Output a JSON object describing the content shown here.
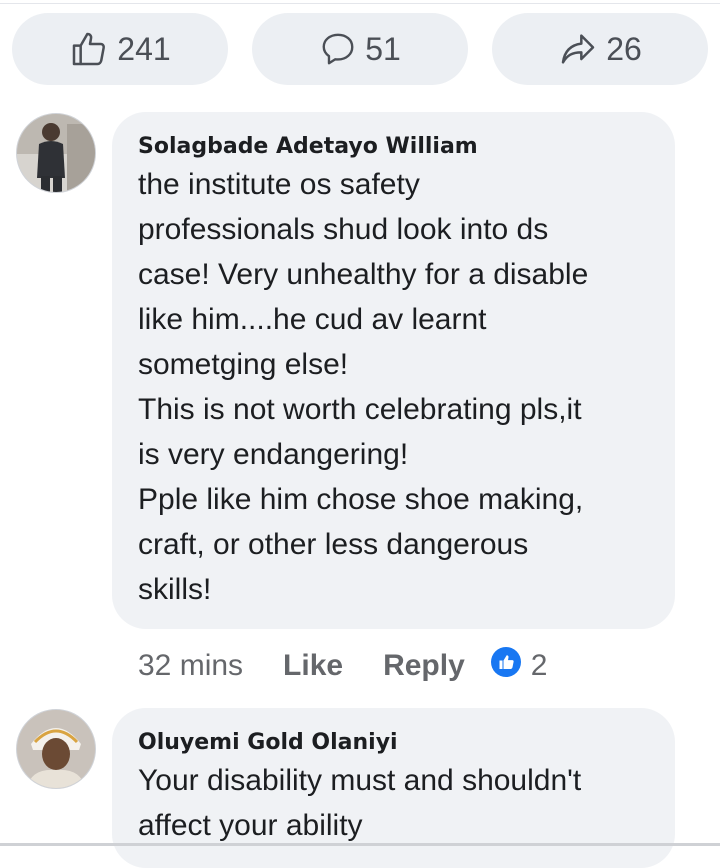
{
  "reactions": {
    "likes": {
      "icon": "thumbs-up-icon",
      "count": "241"
    },
    "comments": {
      "icon": "comment-icon",
      "count": "51"
    },
    "shares": {
      "icon": "share-icon",
      "count": "26"
    }
  },
  "comments": [
    {
      "author": "Solagbade Adetayo William",
      "lines": [
        "the institute os safety",
        "professionals shud look into ds",
        "case! Very unhealthy for a disable",
        "like him....he cud av learnt",
        "sometging else!",
        "This is not worth celebrating pls,it",
        "is very endangering!",
        "Pple like him chose shoe making,",
        "craft, or other less dangerous",
        "skills!"
      ],
      "time": "32 mins",
      "like_label": "Like",
      "reply_label": "Reply",
      "reaction_count": "2",
      "reaction_color": "#1877f2"
    },
    {
      "author": "Oluyemi Gold Olaniyi",
      "lines": [
        "Your disability must and shouldn't",
        "affect your ability"
      ]
    }
  ],
  "colors": {
    "bubble": "#f0f2f5",
    "pill": "#eceff3",
    "meta_text": "#65676b",
    "like_blue": "#1877f2"
  }
}
